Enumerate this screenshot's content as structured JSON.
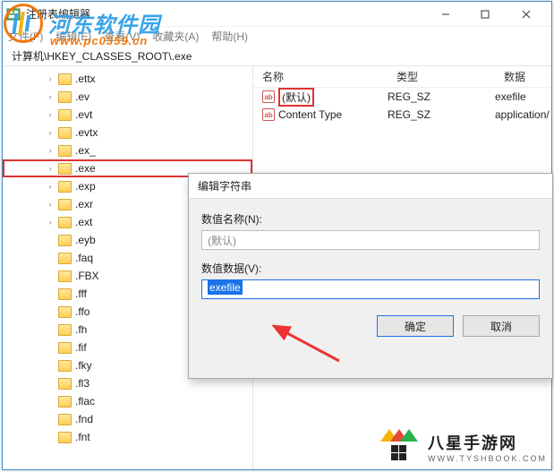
{
  "window": {
    "title": "注册表编辑器"
  },
  "menu": {
    "file": "文件(F)",
    "edit": "编辑(E)",
    "view": "查看(V)",
    "favorites": "收藏夹(A)",
    "help": "帮助(H)"
  },
  "path": "计算机\\HKEY_CLASSES_ROOT\\.exe",
  "tree": {
    "items": [
      ".ettx",
      ".ev",
      ".evt",
      ".evtx",
      ".ex_",
      ".exe",
      ".exp",
      ".exr",
      ".ext",
      ".eyb",
      ".faq",
      ".FBX",
      ".fff",
      ".ffo",
      ".fh",
      ".fif",
      ".fky",
      ".fl3",
      ".flac",
      ".fnd",
      ".fnt"
    ]
  },
  "list": {
    "cols": {
      "name": "名称",
      "type": "类型",
      "data": "数据"
    },
    "rows": [
      {
        "name": "(默认)",
        "type": "REG_SZ",
        "data": "exefile",
        "hl": true
      },
      {
        "name": "Content Type",
        "type": "REG_SZ",
        "data": "application/",
        "hl": false
      }
    ]
  },
  "dialog": {
    "title": "编辑字符串",
    "name_label": "数值名称(N):",
    "name_value": "(默认)",
    "data_label": "数值数据(V):",
    "data_value": "exefile",
    "ok": "确定",
    "cancel": "取消"
  },
  "watermark1": {
    "brand": "河东软件园",
    "url": "www.pc0359.cn"
  },
  "watermark2": {
    "brand": "八星手游网",
    "url": "WWW.TYSHBOOK.COM"
  }
}
